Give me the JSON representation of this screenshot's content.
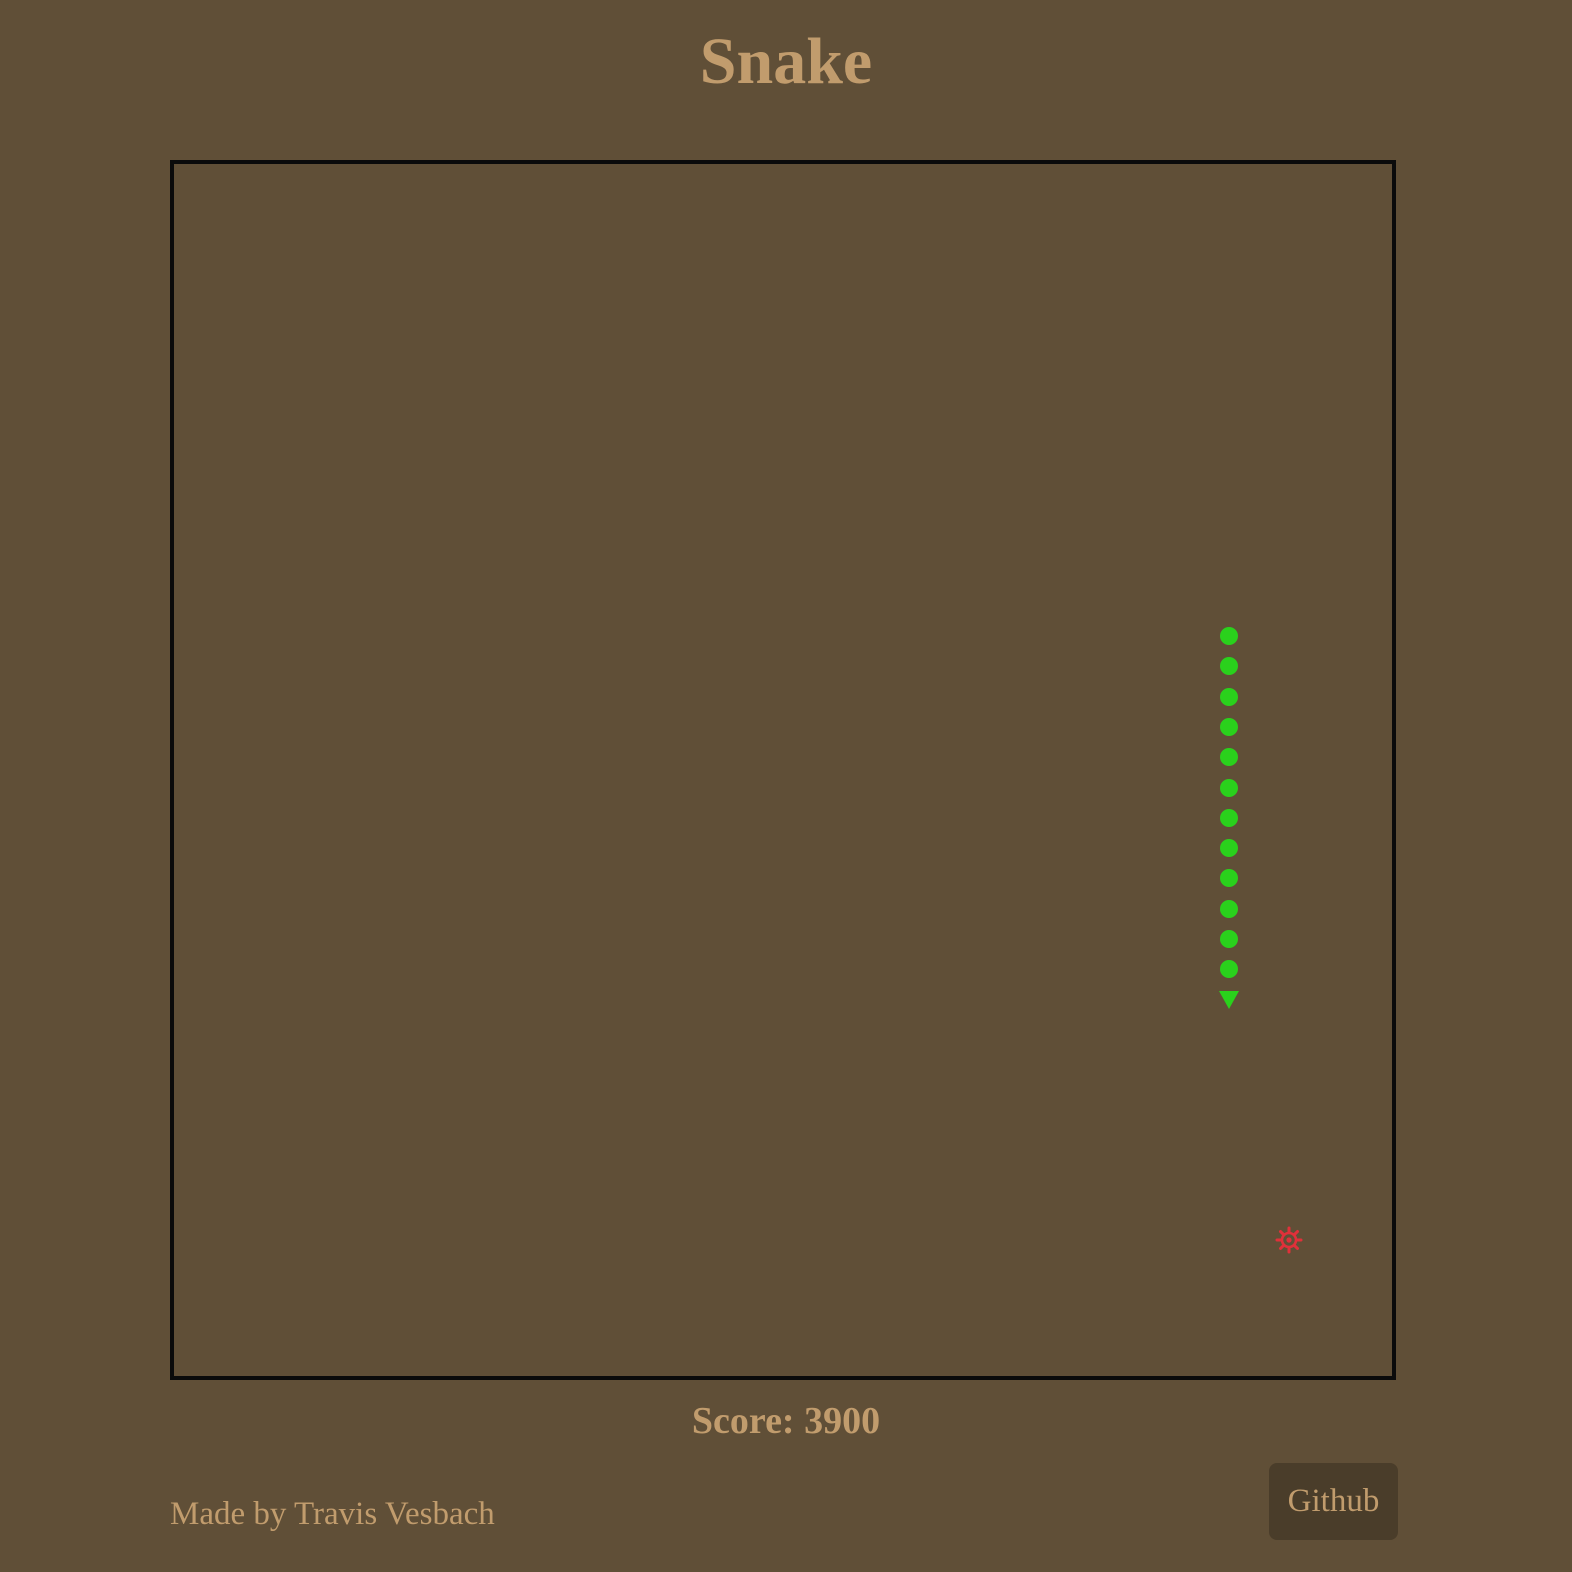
{
  "header": {
    "title": "Snake"
  },
  "game": {
    "snake": {
      "color": "#2ad11c",
      "body_segments": 12,
      "direction": "down"
    },
    "food": {
      "color": "#e0303a",
      "icon": "gear-icon"
    },
    "border_color": "#0b0b0b",
    "background": "#604f37"
  },
  "score": {
    "text": "Score: 3900"
  },
  "footer": {
    "credit": "Made by Travis Vesbach",
    "github_label": "Github"
  }
}
